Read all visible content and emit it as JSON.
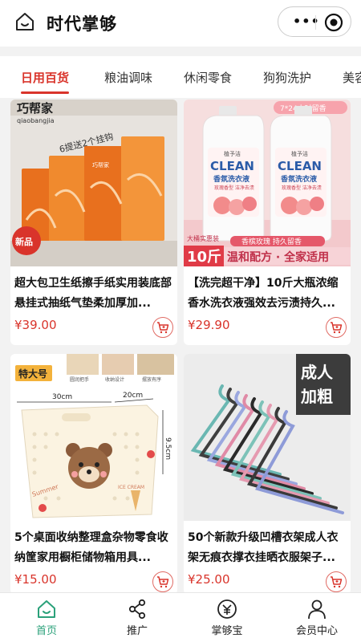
{
  "header": {
    "title": "时代掌够",
    "capsule_dots": "•••"
  },
  "tabs": [
    {
      "label": "日用百货",
      "active": true
    },
    {
      "label": "粮油调味",
      "active": false
    },
    {
      "label": "休闲零食",
      "active": false
    },
    {
      "label": "狗狗洗护",
      "active": false
    },
    {
      "label": "美容",
      "active": false
    }
  ],
  "products": [
    {
      "name": "超大包卫生纸擦手纸实用装底部悬挂式抽纸气垫柔加厚加...",
      "price": "¥39.00",
      "image_text": {
        "brand": "巧帮家",
        "brand_pinyin": "qiaobangjia",
        "promo": "6提送2个挂钩",
        "badge": "新品",
        "box_brand": "巧帮家"
      }
    },
    {
      "name": "【洗完超干净】10斤大瓶浓缩香水洗衣液强效去污渍持久...",
      "price": "¥29.90",
      "image_text": {
        "top_tag": "7*24小时留香",
        "bottle_brand": "植予洁",
        "clean": "CLEAN",
        "bottle_sub": "香氛洗衣液",
        "bottle_small": "玫瑰香型 洁净去渍",
        "size_tag": "大桶实惠装",
        "size": "10斤",
        "line1": "香槟玫瑰 持久留香",
        "line2": "温和配方 · 全家适用"
      }
    },
    {
      "name": "5个桌面收纳整理盒杂物零食收纳筐家用橱柜储物箱用具...",
      "price": "¥15.00",
      "image_text": {
        "size_label": "特大号",
        "dim_w": "30cm",
        "dim_d": "20cm",
        "dim_h": "9.5cm",
        "feature1": "圆润把手",
        "feature2": "收纳设计",
        "feature3": "摆放有序",
        "basket_text": "Summer",
        "cone_text": "ICE CREAM"
      }
    },
    {
      "name": "50个新款升级凹槽衣架成人衣架无痕衣撑衣挂晒衣服架子...",
      "price": "¥25.00",
      "image_text": {
        "tag_line1": "成人",
        "tag_line2": "加粗"
      }
    }
  ],
  "bottom_nav": [
    {
      "label": "首页",
      "icon": "home-icon",
      "active": true
    },
    {
      "label": "推广",
      "icon": "share-icon",
      "active": false
    },
    {
      "label": "掌够宝",
      "icon": "wallet-icon",
      "active": false
    },
    {
      "label": "会员中心",
      "icon": "user-icon",
      "active": false
    }
  ],
  "colors": {
    "accent": "#d9342b",
    "nav_active": "#2ba17a",
    "background": "#f2f2f2"
  }
}
